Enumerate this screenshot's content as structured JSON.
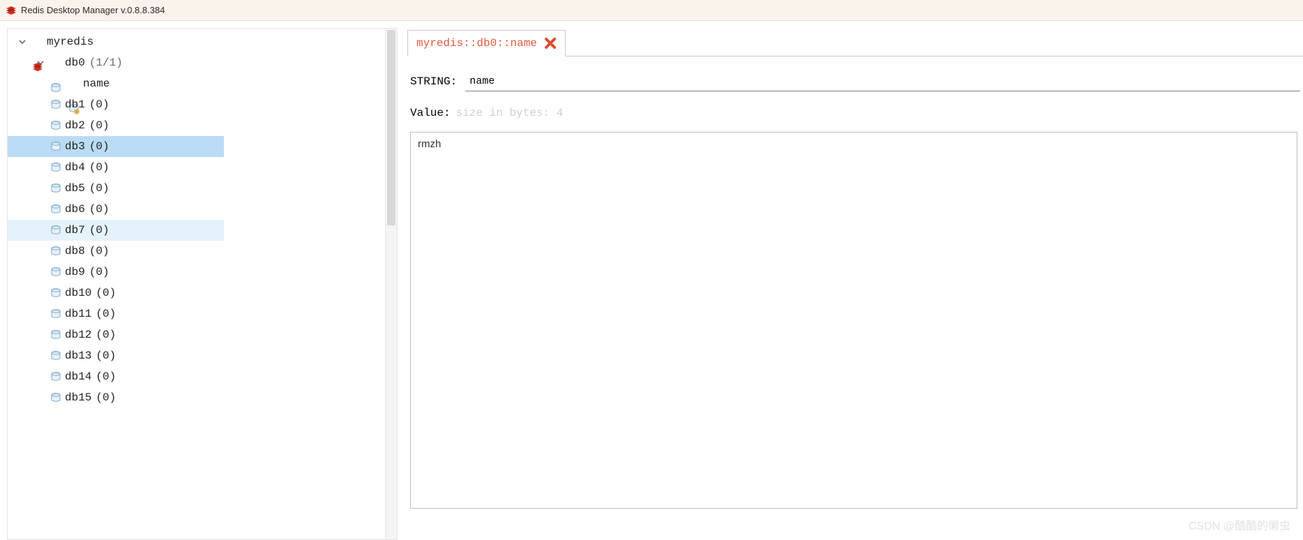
{
  "window": {
    "title": "Redis Desktop Manager v.0.8.8.384"
  },
  "tree": {
    "connection": "myredis",
    "root_expanded": true,
    "db0": {
      "label": "db0",
      "count_display": "(1/1)",
      "expanded": true
    },
    "key0": {
      "label": "name"
    },
    "dbs": [
      {
        "label": "db1",
        "count": "(0)",
        "state": ""
      },
      {
        "label": "db2",
        "count": "(0)",
        "state": ""
      },
      {
        "label": "db3",
        "count": "(0)",
        "state": "selected"
      },
      {
        "label": "db4",
        "count": "(0)",
        "state": ""
      },
      {
        "label": "db5",
        "count": "(0)",
        "state": ""
      },
      {
        "label": "db6",
        "count": "(0)",
        "state": ""
      },
      {
        "label": "db7",
        "count": "(0)",
        "state": "hover"
      },
      {
        "label": "db8",
        "count": "(0)",
        "state": ""
      },
      {
        "label": "db9",
        "count": "(0)",
        "state": ""
      },
      {
        "label": "db10",
        "count": "(0)",
        "state": ""
      },
      {
        "label": "db11",
        "count": "(0)",
        "state": ""
      },
      {
        "label": "db12",
        "count": "(0)",
        "state": ""
      },
      {
        "label": "db13",
        "count": "(0)",
        "state": ""
      },
      {
        "label": "db14",
        "count": "(0)",
        "state": ""
      },
      {
        "label": "db15",
        "count": "(0)",
        "state": ""
      }
    ]
  },
  "tab": {
    "title": "myredis::db0::name"
  },
  "editor": {
    "type_label": "STRING:",
    "key_value": "name",
    "value_label": "Value:",
    "size_hint": "size in bytes: 4",
    "value_content": "rmzh"
  },
  "watermark": "CSDN @酷酷的懒虫"
}
